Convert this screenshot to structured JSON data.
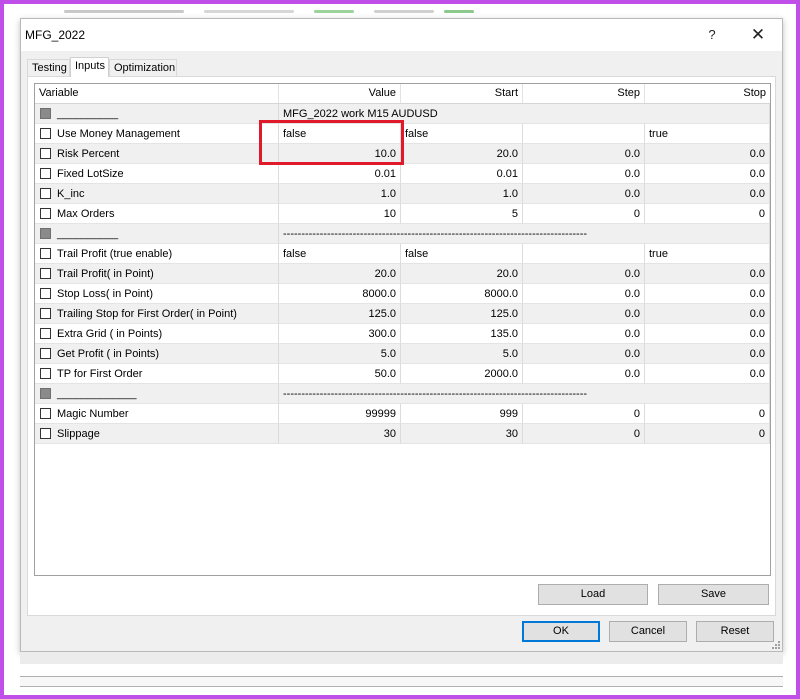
{
  "window": {
    "title": "MFG_2022",
    "help_label": "?",
    "close_label": "✕"
  },
  "tabs": [
    {
      "label": "Testing"
    },
    {
      "label": "Inputs"
    },
    {
      "label": "Optimization"
    }
  ],
  "active_tab": "Inputs",
  "columns": {
    "variable": "Variable",
    "value": "Value",
    "start": "Start",
    "step": "Step",
    "stop": "Stop"
  },
  "rows": [
    {
      "kind": "section",
      "name": "__________",
      "note": "MFG_2022 work M15 AUDUSD"
    },
    {
      "kind": "param",
      "name": "Use Money Management",
      "value": "false",
      "start": "false",
      "step": "",
      "stop": "true",
      "text": true
    },
    {
      "kind": "param",
      "name": "Risk Percent",
      "value": "10.0",
      "start": "20.0",
      "step": "0.0",
      "stop": "0.0"
    },
    {
      "kind": "param",
      "name": "Fixed LotSize",
      "value": "0.01",
      "start": "0.01",
      "step": "0.0",
      "stop": "0.0"
    },
    {
      "kind": "param",
      "name": "K_inc",
      "value": "1.0",
      "start": "1.0",
      "step": "0.0",
      "stop": "0.0"
    },
    {
      "kind": "param",
      "name": "Max Orders",
      "value": "10",
      "start": "5",
      "step": "0",
      "stop": "0"
    },
    {
      "kind": "section",
      "name": "__________",
      "note": "-----------------------------------------------------------------------------------"
    },
    {
      "kind": "param",
      "name": "Trail Profit (true enable)",
      "value": "false",
      "start": "false",
      "step": "",
      "stop": "true",
      "text": true
    },
    {
      "kind": "param",
      "name": "Trail Profit( in Point)",
      "value": "20.0",
      "start": "20.0",
      "step": "0.0",
      "stop": "0.0"
    },
    {
      "kind": "param",
      "name": "Stop Loss( in Point)",
      "value": "8000.0",
      "start": "8000.0",
      "step": "0.0",
      "stop": "0.0"
    },
    {
      "kind": "param",
      "name": "Trailing Stop for First Order( in Point)",
      "value": "125.0",
      "start": "125.0",
      "step": "0.0",
      "stop": "0.0"
    },
    {
      "kind": "param",
      "name": "Extra Grid ( in Points)",
      "value": "300.0",
      "start": "135.0",
      "step": "0.0",
      "stop": "0.0"
    },
    {
      "kind": "param",
      "name": "Get Profit ( in Points)",
      "value": "5.0",
      "start": "5.0",
      "step": "0.0",
      "stop": "0.0"
    },
    {
      "kind": "param",
      "name": "TP for First Order",
      "value": "50.0",
      "start": "2000.0",
      "step": "0.0",
      "stop": "0.0"
    },
    {
      "kind": "section",
      "name": "_____________",
      "note": "-----------------------------------------------------------------------------------"
    },
    {
      "kind": "param",
      "name": "Magic Number",
      "value": "99999",
      "start": "999",
      "step": "0",
      "stop": "0"
    },
    {
      "kind": "param",
      "name": "Slippage",
      "value": "30",
      "start": "30",
      "step": "0",
      "stop": "0"
    }
  ],
  "buttons": {
    "load": "Load",
    "save": "Save",
    "ok": "OK",
    "cancel": "Cancel",
    "reset": "Reset"
  },
  "colors": {
    "frame": "#c04ee8",
    "highlight": "#e0192b",
    "default_button": "#0078d7"
  }
}
